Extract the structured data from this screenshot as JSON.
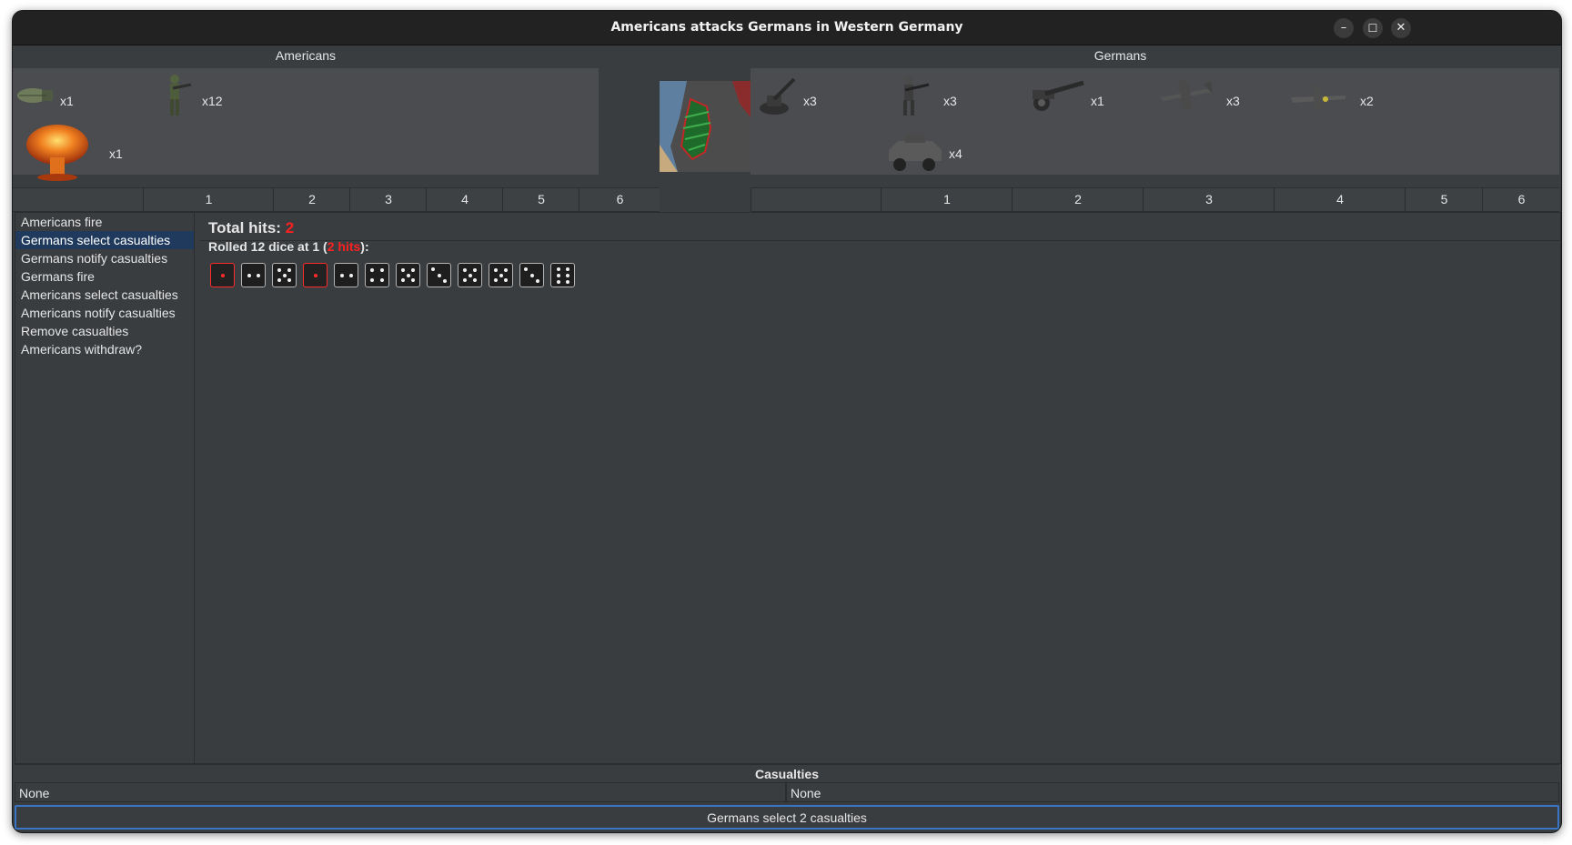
{
  "window": {
    "title": "Americans attacks Germans in Western Germany",
    "minimize": "–",
    "maximize": "☐",
    "close": "✕"
  },
  "attacker": {
    "name": "Americans",
    "units": [
      {
        "icon": "bomb-icon",
        "count": "x1"
      },
      {
        "icon": "infantry-icon",
        "count": "x12"
      },
      {
        "icon": "nuclear-explosion-icon",
        "count": "x1"
      }
    ],
    "dice_columns": [
      "1",
      "2",
      "3",
      "4",
      "5",
      "6"
    ]
  },
  "defender": {
    "name": "Germans",
    "units": [
      {
        "icon": "anti-aircraft-gun-icon",
        "count": "x3"
      },
      {
        "icon": "infantry-icon",
        "count": "x3"
      },
      {
        "icon": "artillery-icon",
        "count": "x1"
      },
      {
        "icon": "fighter-plane-icon",
        "count": "x3"
      },
      {
        "icon": "fighter-plane-icon",
        "count": "x2"
      },
      {
        "icon": "armored-car-icon",
        "count": "x4"
      }
    ],
    "dice_columns": [
      "1",
      "2",
      "3",
      "4",
      "5",
      "6"
    ]
  },
  "territory_map": {
    "icon": "territory-map-icon"
  },
  "steps": [
    {
      "label": "Americans fire",
      "selected": false
    },
    {
      "label": "Germans select casualties",
      "selected": true
    },
    {
      "label": "Germans notify casualties",
      "selected": false
    },
    {
      "label": "Germans fire",
      "selected": false
    },
    {
      "label": "Americans select casualties",
      "selected": false
    },
    {
      "label": "Americans notify casualties",
      "selected": false
    },
    {
      "label": "Remove casualties",
      "selected": false
    },
    {
      "label": "Americans withdraw?",
      "selected": false
    }
  ],
  "results": {
    "total_label": "Total hits: ",
    "total_value": "2",
    "rolled_prefix": "Rolled 12 dice at 1 (",
    "rolled_hits": "2 hits",
    "rolled_suffix": "):",
    "dice": [
      1,
      2,
      5,
      1,
      2,
      4,
      5,
      3,
      5,
      5,
      3,
      6
    ],
    "hit_color": "#ff2a2a"
  },
  "casualties": {
    "heading": "Casualties",
    "attacker": "None",
    "defender": "None"
  },
  "status_button": "Germans select 2 casualties"
}
